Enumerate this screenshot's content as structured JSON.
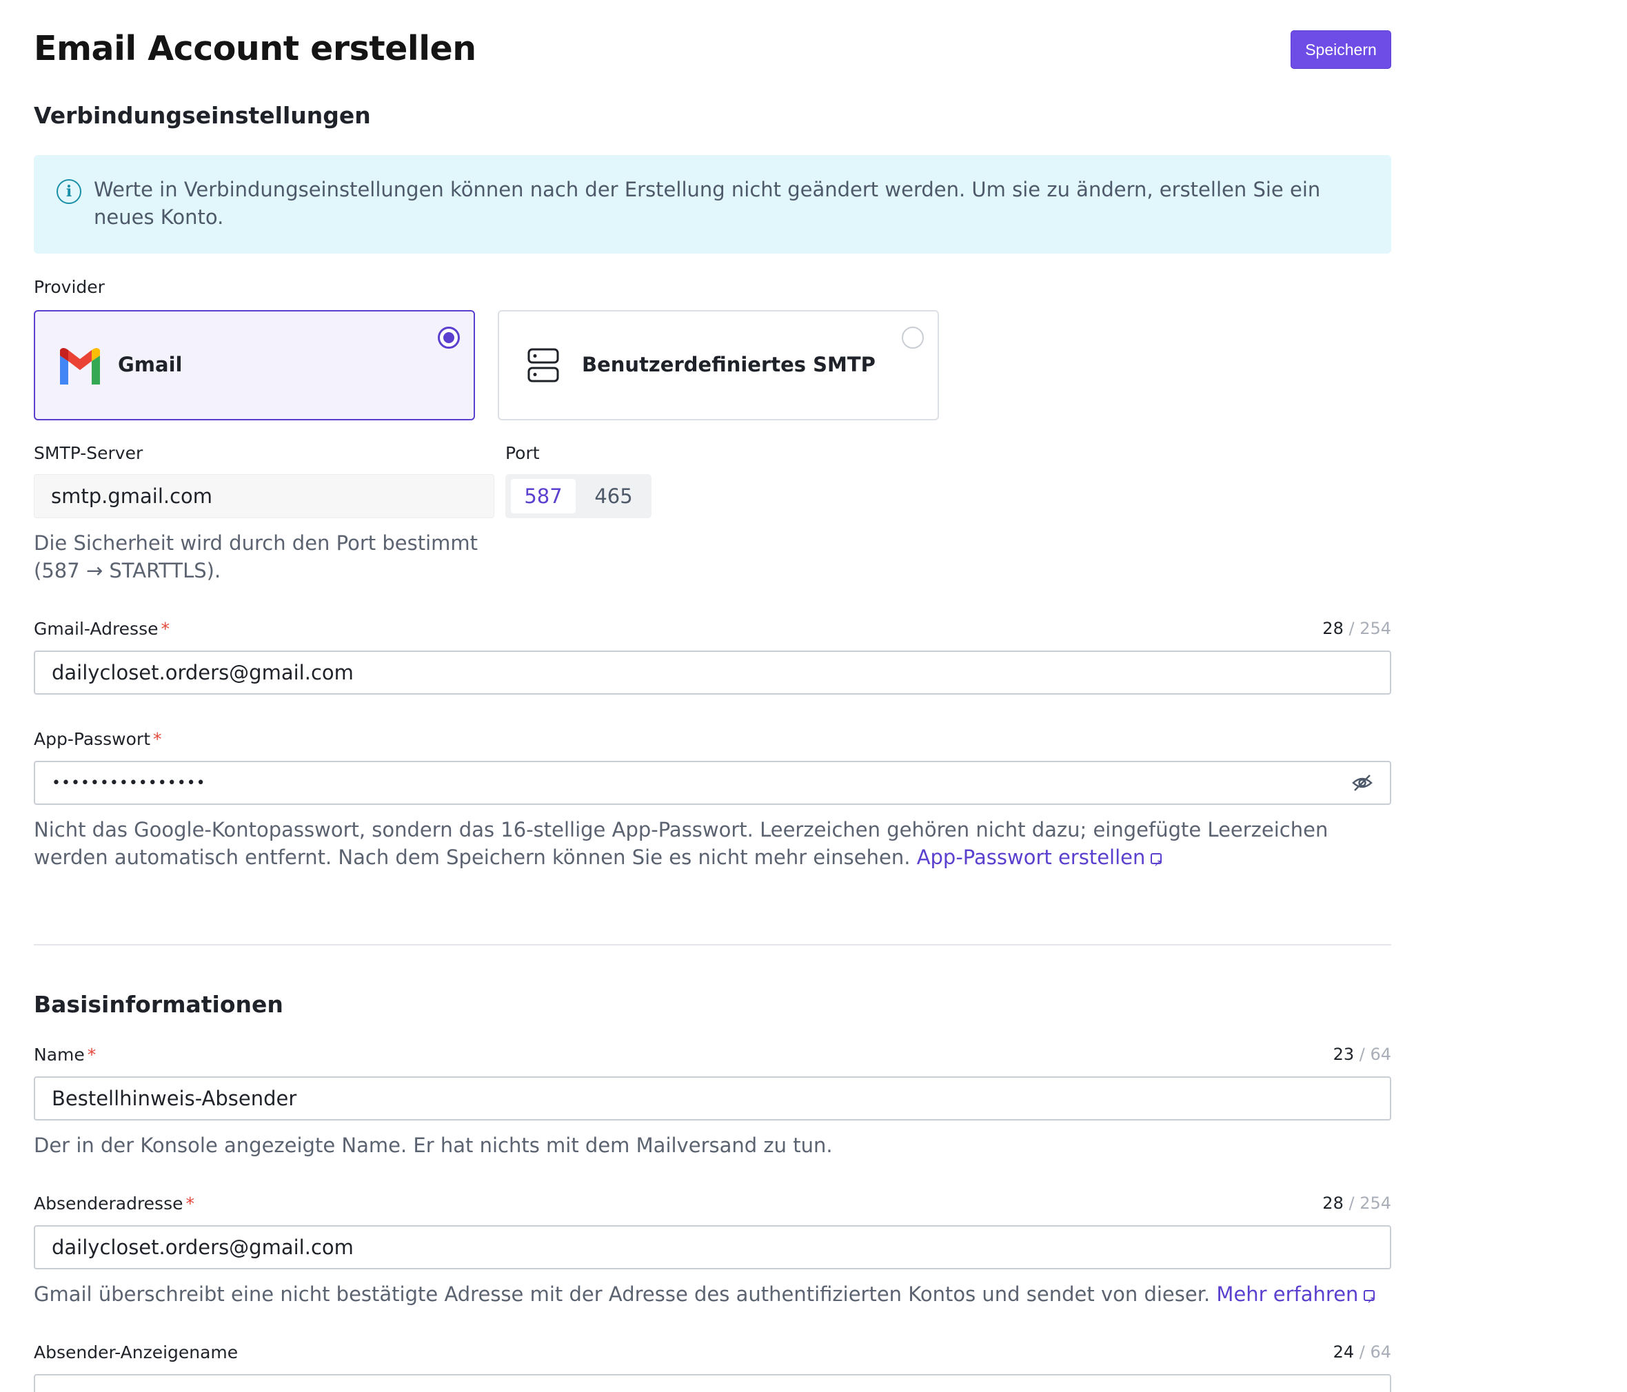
{
  "header": {
    "title": "Email Account erstellen",
    "save_label": "Speichern"
  },
  "connection": {
    "title": "Verbindungseinstellungen",
    "info": "Werte in Verbindungseinstellungen können nach der Erstellung nicht geändert werden. Um sie zu ändern, erstellen Sie ein neues Konto.",
    "provider_label": "Provider",
    "providers": [
      {
        "label": "Gmail",
        "selected": true,
        "icon": "gmail-icon"
      },
      {
        "label": "Benutzerdefiniertes SMTP",
        "selected": false,
        "icon": "server-icon"
      }
    ],
    "smtp_label": "SMTP-Server",
    "smtp_value": "smtp.gmail.com",
    "port_label": "Port",
    "ports": [
      "587",
      "465"
    ],
    "port_selected": "587",
    "security_help": "Die Sicherheit wird durch den Port bestimmt (587 → STARTTLS).",
    "gmail_label": "Gmail-Adresse",
    "gmail_count": "28",
    "gmail_max": " / 254",
    "gmail_value": "dailycloset.orders@gmail.com",
    "apppw_label": "App-Passwort",
    "apppw_value": "••••••••••••••••",
    "apppw_help": "Nicht das Google-Kontopasswort, sondern das 16-stellige App-Passwort. Leerzeichen gehören nicht dazu; eingefügte Leerzeichen werden automatisch entfernt. Nach dem Speichern können Sie es nicht mehr einsehen.",
    "apppw_link": "App-Passwort erstellen"
  },
  "basic": {
    "title": "Basisinformationen",
    "name_label": "Name",
    "name_count": "23",
    "name_max": " / 64",
    "name_value": "Bestellhinweis-Absender",
    "name_help": "Der in der Konsole angezeigte Name. Er hat nichts mit dem Mailversand zu tun.",
    "sender_label": "Absenderadresse",
    "sender_count": "28",
    "sender_max": " / 254",
    "sender_value": "dailycloset.orders@gmail.com",
    "sender_help": "Gmail überschreibt eine nicht bestätigte Adresse mit der Adresse des authentifizierten Kontos und sendet von dieser.",
    "sender_link": "Mehr erfahren",
    "display_label": "Absender-Anzeigename",
    "display_count": "24",
    "display_max": " / 64"
  }
}
